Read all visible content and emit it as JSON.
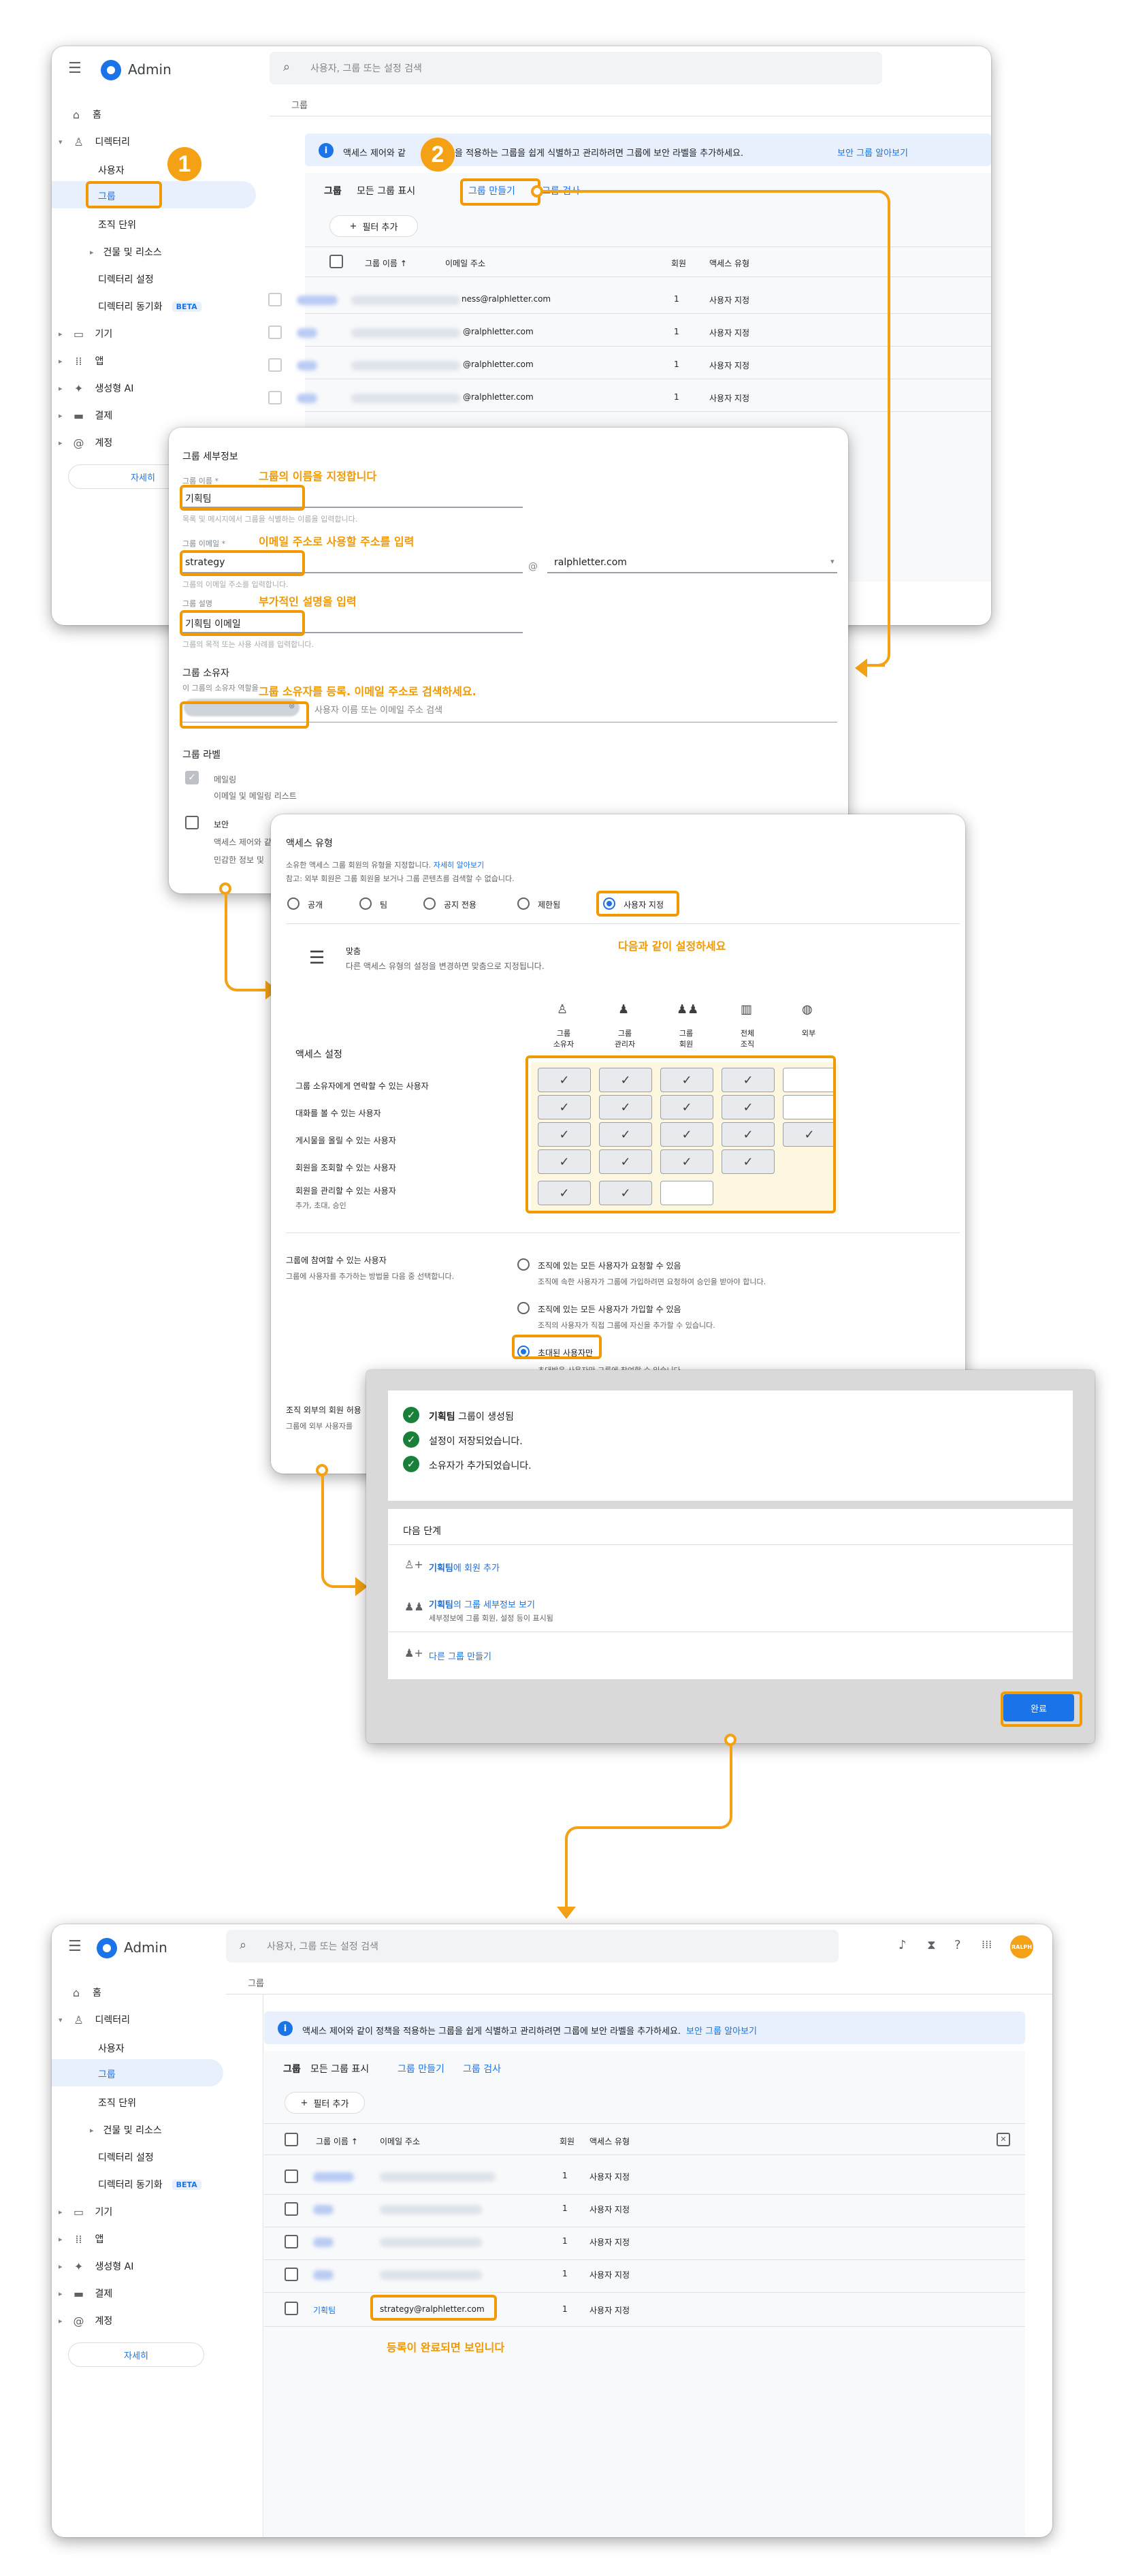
{
  "header": {
    "app_name": "Admin",
    "search_placeholder": "사용자, 그룹 또는 설정 검색",
    "breadcrumb": "그룹",
    "avatar_text": "RALPH"
  },
  "sidebar": {
    "items": [
      {
        "label": "홈",
        "icon": "home-icon"
      },
      {
        "label": "디렉터리",
        "icon": "person-icon"
      },
      {
        "label": "사용자"
      },
      {
        "label": "그룹"
      },
      {
        "label": "조직 단위"
      },
      {
        "label": "건물 및 리소스"
      },
      {
        "label": "디렉터리 설정"
      },
      {
        "label": "디렉터리 동기화",
        "badge": "BETA"
      },
      {
        "label": "기기",
        "icon": "devices-icon"
      },
      {
        "label": "앱",
        "icon": "apps-icon"
      },
      {
        "label": "생성형 AI",
        "icon": "sparkle-icon"
      },
      {
        "label": "결제",
        "icon": "card-icon"
      },
      {
        "label": "계정",
        "icon": "at-icon"
      }
    ],
    "more_button": "자세히"
  },
  "banner": {
    "text": "액세스 제어와 같이 정책을 적용하는 그룹을 쉽게 식별하고 관리하려면 그룹에 보안 라벨을 추가하세요.",
    "text_partial_left": "액세스 제어와 같",
    "text_partial_right": "을 적용하는 그룹을 쉽게 식별하고 관리하려면 그룹에 보안 라벨을 추가하세요.",
    "link": "보안 그룹 알아보기"
  },
  "groups_toolbar": {
    "title": "그룹",
    "show_all": "모든 그룹 표시",
    "create": "그룹 만들기",
    "search": "그룹 검사",
    "search_partial": "그룹 검사",
    "filter": "필터 추가"
  },
  "table": {
    "columns": [
      "그룹 이름",
      "이메일 주소",
      "회원",
      "액세스 유형"
    ],
    "rows_top": [
      {
        "email_suffix": "ness@ralphletter.com",
        "members": "1",
        "access": "사용자 지정"
      },
      {
        "email_suffix": "@ralphletter.com",
        "members": "1",
        "access": "사용자 지정"
      },
      {
        "email_suffix": "@ralphletter.com",
        "members": "1",
        "access": "사용자 지정"
      },
      {
        "email_suffix": "@ralphletter.com",
        "members": "1",
        "access": "사용자 지정"
      }
    ],
    "rows_bottom": [
      {
        "members": "1",
        "access": "사용자 지정"
      },
      {
        "members": "1",
        "access": "사용자 지정"
      },
      {
        "members": "1",
        "access": "사용자 지정"
      },
      {
        "members": "1",
        "access": "사용자 지정"
      },
      {
        "name": "기획팀",
        "email": "strategy@ralphletter.com",
        "members": "1",
        "access": "사용자 지정"
      }
    ]
  },
  "details_form": {
    "section_title": "그룹 세부정보",
    "name_label": "그룹 이름 *",
    "name_value": "기획팀",
    "name_hint": "목록 및 메시지에서 그룹을 식별하는 이름을 입력합니다.",
    "email_label": "그룹 이메일 *",
    "email_value": "strategy",
    "email_hint": "그룹의 이메일 주소를 입력합니다.",
    "at": "@",
    "domain": "ralphletter.com",
    "desc_label": "그룹 설명",
    "desc_value": "기획팀 이메일",
    "desc_hint": "그룹의 목적 또는 사용 사례를 입력합니다.",
    "owner_title": "그룹 소유자",
    "owner_hint": "이 그룹의 소유자 역할을",
    "owner_placeholder": "사용자 이름 또는 이메일 주소 검색",
    "label_title": "그룹 라벨",
    "label_mail": "메일링",
    "label_mail_desc": "이메일 및 메일링 리스트",
    "label_security": "보안",
    "label_security_desc1": "액세스 제어와 같",
    "label_security_desc2": "민감한 정보 및"
  },
  "annotations": {
    "name": "그룹의 이름을 지정합니다",
    "email": "이메일 주소로 사용할 주소를 입력",
    "desc": "부가적인 설명을 입력",
    "owner": "그룹 소유자를 등록. 이메일 주소로 검색하세요.",
    "access": "다음과 같이 설정하세요",
    "done": "등록이 완료되면 보입니다"
  },
  "badges": {
    "one": "1",
    "two": "2"
  },
  "access": {
    "title": "액세스 유형",
    "desc1": "소유한 액세스 그룹 회원의 유형을 지정합니다.",
    "desc1_link": "자세히 알아보기",
    "desc2": "참고: 외부 회원은 그룹 회원을 보거나 그룹 콘텐츠를 검색할 수 없습니다.",
    "options": [
      "공개",
      "팀",
      "공지 전용",
      "제한됨",
      "사용자 지정"
    ],
    "custom_title": "맞춤",
    "custom_desc": "다른 액세스 유형의 설정을 변경하면 맞춤으로 지정됩니다.",
    "settings_label": "액세스 설정",
    "col_headers": [
      [
        "그룹",
        "소유자"
      ],
      [
        "그룹",
        "관리자"
      ],
      [
        "그룹",
        "회원"
      ],
      [
        "전체",
        "조직"
      ],
      [
        "외부",
        ""
      ]
    ],
    "rows": [
      {
        "label": "그룹 소유자에게 연락할 수 있는 사용자",
        "sub": ""
      },
      {
        "label": "대화를 볼 수 있는 사용자",
        "sub": ""
      },
      {
        "label": "게시물을 올릴 수 있는 사용자",
        "sub": ""
      },
      {
        "label": "회원을 조회할 수 있는 사용자",
        "sub": ""
      },
      {
        "label": "회원을 관리할 수 있는 사용자",
        "sub": "추가, 초대, 승인"
      }
    ],
    "check": "✓",
    "join_title": "그룹에 참여할 수 있는 사용자",
    "join_desc": "그룹에 사용자를 추가하는 방법을 다음 중 선택합니다.",
    "join_options": [
      {
        "label": "조직에 있는 모든 사용자가 요청할 수 있음",
        "desc": "조직에 속한 사용자가 그룹에 가입하려면 요청하여 승인을 받아야 합니다."
      },
      {
        "label": "조직에 있는 모든 사용자가 가입할 수 있음",
        "desc": "조직의 사용자가 직접 그룹에 자신을 추가할 수 있습니다."
      },
      {
        "label": "초대된 사용자만",
        "desc": "초대받은 사용자만 그룹에 참여할 수 있습니다."
      }
    ],
    "external_title": "조직 외부의 회원 허용",
    "external_desc": "그룹에 외부 사용자를"
  },
  "success": {
    "group_name": "기획팀",
    "line1_suffix": " 그룹이 생성됨",
    "line2": "설정이 저장되었습니다.",
    "line3": "소유자가 추가되었습니다.",
    "next_title": "다음 단계",
    "next1_suffix": "에 회원 추가",
    "next2_suffix": "의 그룹 세부정보 보기",
    "next2_desc": "세부정보에 그룹 회원, 설정 등이 표시됨",
    "next3": "다른 그룹 만들기",
    "done_button": "완료"
  },
  "colors": {
    "accent": "#f29900",
    "blue": "#1a73e8",
    "success": "#188038"
  }
}
